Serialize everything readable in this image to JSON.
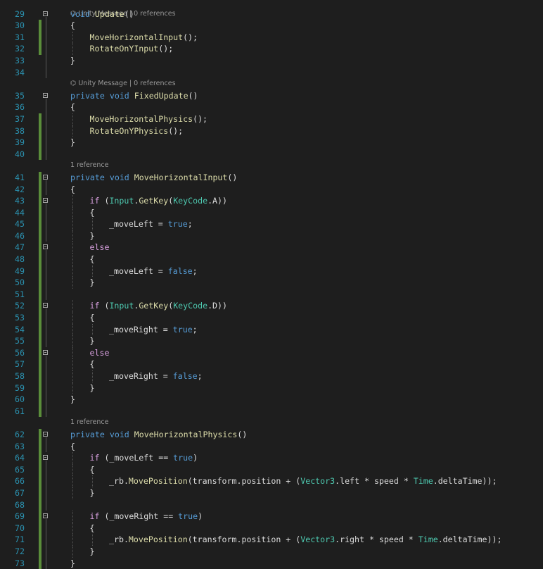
{
  "editor": {
    "top_lens": {
      "text": "⌬ Unity Message | 0 references"
    },
    "rows": [
      {
        "ln": "29",
        "fold": true,
        "bar": false,
        "indent": 0,
        "tokens": [
          [
            "kw",
            "void"
          ],
          [
            "tx",
            " "
          ],
          [
            "fn",
            "Update"
          ],
          [
            "tx",
            "()"
          ]
        ]
      },
      {
        "ln": "30",
        "bar": true,
        "indent": 0,
        "tokens": [
          [
            "tx",
            "{"
          ]
        ]
      },
      {
        "ln": "31",
        "bar": true,
        "indent": 1,
        "tokens": [
          [
            "fn",
            "MoveHorizontalInput"
          ],
          [
            "tx",
            "();"
          ]
        ]
      },
      {
        "ln": "32",
        "bar": true,
        "indent": 1,
        "tokens": [
          [
            "fn",
            "RotateOnYInput"
          ],
          [
            "tx",
            "();"
          ]
        ]
      },
      {
        "ln": "33",
        "indent": 0,
        "tokens": [
          [
            "tx",
            "}"
          ]
        ]
      },
      {
        "ln": "34",
        "indent": 0,
        "tokens": []
      },
      {
        "lens": "⌬ Unity Message | 0 references"
      },
      {
        "ln": "35",
        "fold": true,
        "indent": 0,
        "tokens": [
          [
            "kw",
            "private"
          ],
          [
            "tx",
            " "
          ],
          [
            "kw",
            "void"
          ],
          [
            "tx",
            " "
          ],
          [
            "fn",
            "FixedUpdate"
          ],
          [
            "tx",
            "()"
          ]
        ]
      },
      {
        "ln": "36",
        "indent": 0,
        "tokens": [
          [
            "tx",
            "{"
          ]
        ]
      },
      {
        "ln": "37",
        "bar": true,
        "indent": 1,
        "tokens": [
          [
            "fn",
            "MoveHorizontalPhysics"
          ],
          [
            "tx",
            "();"
          ]
        ]
      },
      {
        "ln": "38",
        "bar": true,
        "indent": 1,
        "tokens": [
          [
            "fn",
            "RotateOnYPhysics"
          ],
          [
            "tx",
            "();"
          ]
        ]
      },
      {
        "ln": "39",
        "bar": true,
        "indent": 0,
        "tokens": [
          [
            "tx",
            "}"
          ]
        ]
      },
      {
        "ln": "40",
        "bar": true,
        "indent": 0,
        "tokens": []
      },
      {
        "lens": "1 reference"
      },
      {
        "ln": "41",
        "fold": true,
        "bar": true,
        "indent": 0,
        "tokens": [
          [
            "kw",
            "private"
          ],
          [
            "tx",
            " "
          ],
          [
            "kw",
            "void"
          ],
          [
            "tx",
            " "
          ],
          [
            "fn",
            "MoveHorizontalInput"
          ],
          [
            "tx",
            "()"
          ]
        ]
      },
      {
        "ln": "42",
        "bar": true,
        "indent": 0,
        "tokens": [
          [
            "tx",
            "{"
          ]
        ]
      },
      {
        "ln": "43",
        "fold": true,
        "bar": true,
        "indent": 1,
        "tokens": [
          [
            "ctl",
            "if"
          ],
          [
            "tx",
            " ("
          ],
          [
            "ty",
            "Input"
          ],
          [
            "tx",
            "."
          ],
          [
            "fn",
            "GetKey"
          ],
          [
            "tx",
            "("
          ],
          [
            "ty",
            "KeyCode"
          ],
          [
            "tx",
            ".A))"
          ]
        ]
      },
      {
        "ln": "44",
        "bar": true,
        "indent": 1,
        "tokens": [
          [
            "tx",
            "{"
          ]
        ]
      },
      {
        "ln": "45",
        "bar": true,
        "indent": 2,
        "tokens": [
          [
            "tx",
            "_moveLeft = "
          ],
          [
            "kw",
            "true"
          ],
          [
            "tx",
            ";"
          ]
        ]
      },
      {
        "ln": "46",
        "bar": true,
        "indent": 1,
        "tokens": [
          [
            "tx",
            "}"
          ]
        ]
      },
      {
        "ln": "47",
        "fold": true,
        "bar": true,
        "indent": 1,
        "tokens": [
          [
            "ctl",
            "else"
          ]
        ]
      },
      {
        "ln": "48",
        "bar": true,
        "indent": 1,
        "tokens": [
          [
            "tx",
            "{"
          ]
        ]
      },
      {
        "ln": "49",
        "bar": true,
        "indent": 2,
        "tokens": [
          [
            "tx",
            "_moveLeft = "
          ],
          [
            "kw",
            "false"
          ],
          [
            "tx",
            ";"
          ]
        ]
      },
      {
        "ln": "50",
        "bar": true,
        "indent": 1,
        "tokens": [
          [
            "tx",
            "}"
          ]
        ]
      },
      {
        "ln": "51",
        "bar": true,
        "indent": 0,
        "tokens": []
      },
      {
        "ln": "52",
        "fold": true,
        "bar": true,
        "indent": 1,
        "tokens": [
          [
            "ctl",
            "if"
          ],
          [
            "tx",
            " ("
          ],
          [
            "ty",
            "Input"
          ],
          [
            "tx",
            "."
          ],
          [
            "fn",
            "GetKey"
          ],
          [
            "tx",
            "("
          ],
          [
            "ty",
            "KeyCode"
          ],
          [
            "tx",
            ".D))"
          ]
        ]
      },
      {
        "ln": "53",
        "bar": true,
        "indent": 1,
        "tokens": [
          [
            "tx",
            "{"
          ]
        ]
      },
      {
        "ln": "54",
        "bar": true,
        "indent": 2,
        "tokens": [
          [
            "tx",
            "_moveRight = "
          ],
          [
            "kw",
            "true"
          ],
          [
            "tx",
            ";"
          ]
        ]
      },
      {
        "ln": "55",
        "bar": true,
        "indent": 1,
        "tokens": [
          [
            "tx",
            "}"
          ]
        ]
      },
      {
        "ln": "56",
        "fold": true,
        "bar": true,
        "indent": 1,
        "tokens": [
          [
            "ctl",
            "else"
          ]
        ]
      },
      {
        "ln": "57",
        "bar": true,
        "indent": 1,
        "tokens": [
          [
            "tx",
            "{"
          ]
        ]
      },
      {
        "ln": "58",
        "bar": true,
        "indent": 2,
        "tokens": [
          [
            "tx",
            "_moveRight = "
          ],
          [
            "kw",
            "false"
          ],
          [
            "tx",
            ";"
          ]
        ]
      },
      {
        "ln": "59",
        "bar": true,
        "indent": 1,
        "tokens": [
          [
            "tx",
            "}"
          ]
        ]
      },
      {
        "ln": "60",
        "bar": true,
        "indent": 0,
        "tokens": [
          [
            "tx",
            "}"
          ]
        ]
      },
      {
        "ln": "61",
        "bar": true,
        "indent": 0,
        "tokens": []
      },
      {
        "lens": "1 reference"
      },
      {
        "ln": "62",
        "fold": true,
        "bar": true,
        "indent": 0,
        "tokens": [
          [
            "kw",
            "private"
          ],
          [
            "tx",
            " "
          ],
          [
            "kw",
            "void"
          ],
          [
            "tx",
            " "
          ],
          [
            "fn",
            "MoveHorizontalPhysics"
          ],
          [
            "tx",
            "()"
          ]
        ]
      },
      {
        "ln": "63",
        "bar": true,
        "indent": 0,
        "tokens": [
          [
            "tx",
            "{"
          ]
        ]
      },
      {
        "ln": "64",
        "fold": true,
        "bar": true,
        "indent": 1,
        "tokens": [
          [
            "ctl",
            "if"
          ],
          [
            "tx",
            " (_moveLeft == "
          ],
          [
            "kw",
            "true"
          ],
          [
            "tx",
            ")"
          ]
        ]
      },
      {
        "ln": "65",
        "bar": true,
        "indent": 1,
        "tokens": [
          [
            "tx",
            "{"
          ]
        ]
      },
      {
        "ln": "66",
        "bar": true,
        "indent": 2,
        "tokens": [
          [
            "tx",
            "_rb."
          ],
          [
            "fn",
            "MovePosition"
          ],
          [
            "tx",
            "(transform.position + ("
          ],
          [
            "ty",
            "Vector3"
          ],
          [
            "tx",
            ".left * speed * "
          ],
          [
            "ty",
            "Time"
          ],
          [
            "tx",
            ".deltaTime));"
          ]
        ]
      },
      {
        "ln": "67",
        "bar": true,
        "indent": 1,
        "tokens": [
          [
            "tx",
            "}"
          ]
        ]
      },
      {
        "ln": "68",
        "bar": true,
        "indent": 0,
        "tokens": []
      },
      {
        "ln": "69",
        "fold": true,
        "bar": true,
        "indent": 1,
        "tokens": [
          [
            "ctl",
            "if"
          ],
          [
            "tx",
            " (_moveRight == "
          ],
          [
            "kw",
            "true"
          ],
          [
            "tx",
            ")"
          ]
        ]
      },
      {
        "ln": "70",
        "bar": true,
        "indent": 1,
        "tokens": [
          [
            "tx",
            "{"
          ]
        ]
      },
      {
        "ln": "71",
        "bar": true,
        "indent": 2,
        "tokens": [
          [
            "tx",
            "_rb."
          ],
          [
            "fn",
            "MovePosition"
          ],
          [
            "tx",
            "(transform.position + ("
          ],
          [
            "ty",
            "Vector3"
          ],
          [
            "tx",
            ".right * speed * "
          ],
          [
            "ty",
            "Time"
          ],
          [
            "tx",
            ".deltaTime));"
          ]
        ]
      },
      {
        "ln": "72",
        "bar": true,
        "indent": 1,
        "tokens": [
          [
            "tx",
            "}"
          ]
        ]
      },
      {
        "ln": "73",
        "bar": true,
        "indent": 0,
        "tokens": [
          [
            "tx",
            "}"
          ]
        ]
      }
    ]
  },
  "colors": {
    "background": "#1e1e1e",
    "line_number": "#2b91af",
    "keyword": "#569cd6",
    "control": "#d8a0df",
    "type": "#4ec9b0",
    "method": "#dcdcaa",
    "text": "#dcdcdc",
    "changed_bar": "#5a8d3a"
  },
  "icons": {
    "fold": "collapse-minus-icon",
    "unity": "unity-icon"
  }
}
